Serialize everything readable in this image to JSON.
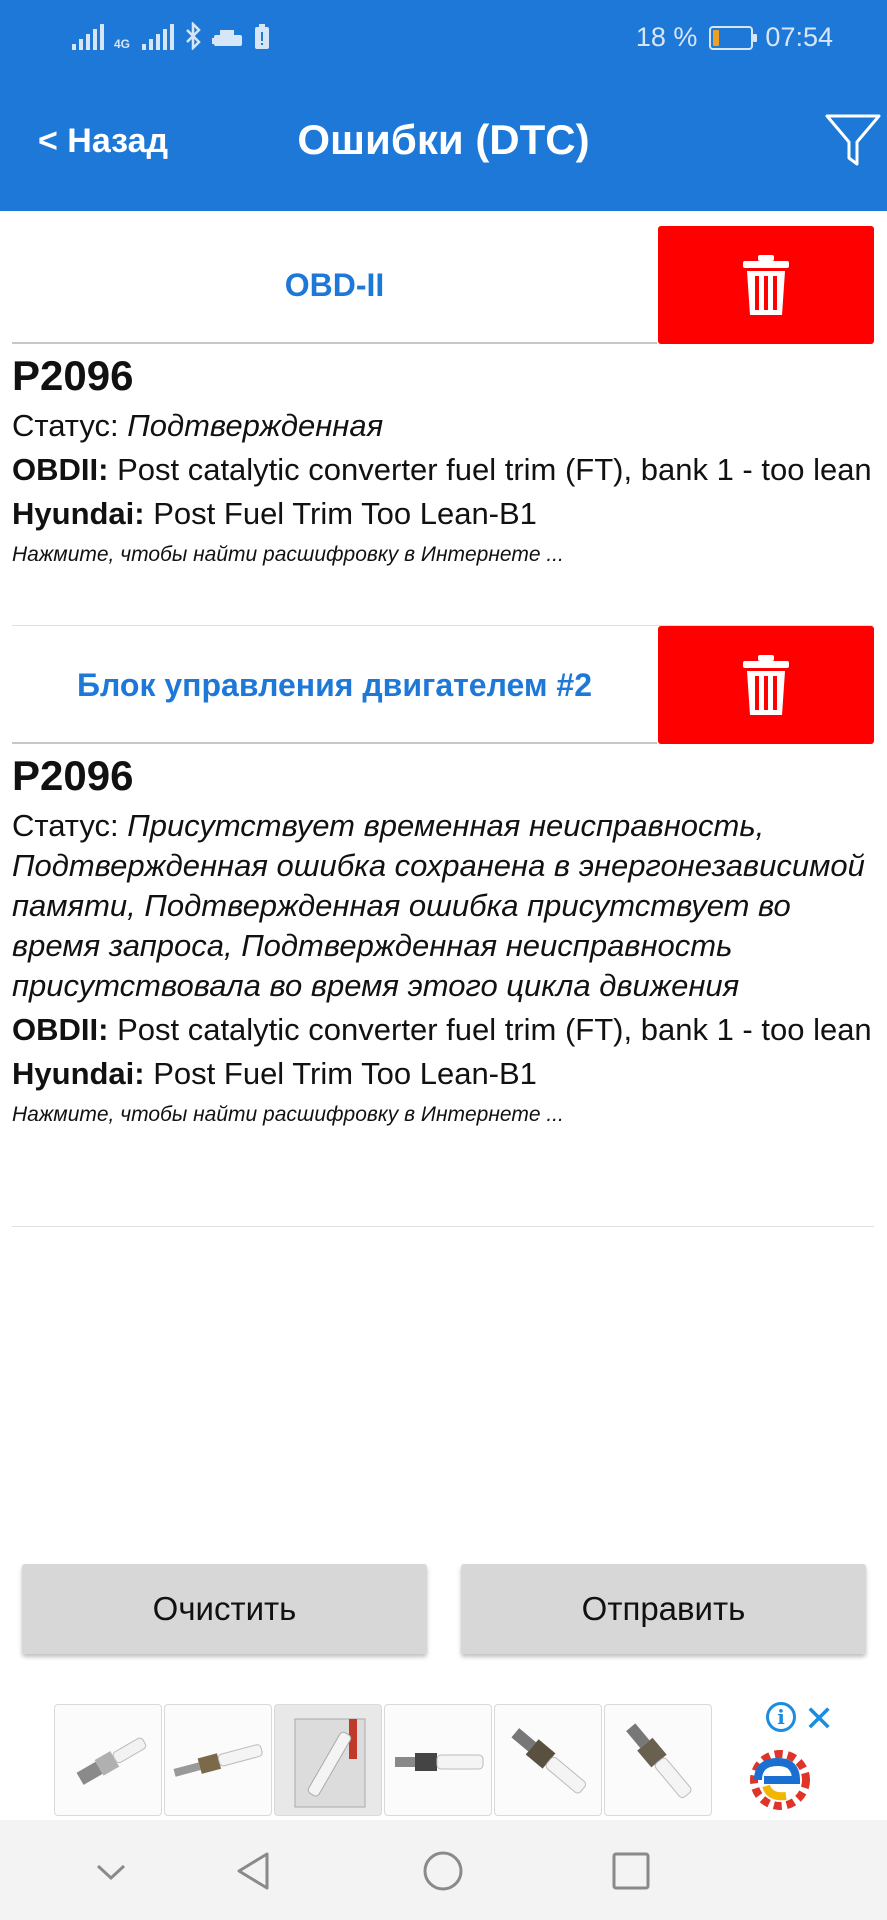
{
  "status_bar": {
    "network_label": "4G",
    "battery_percent": "18 %",
    "battery_level": 0.18,
    "time": "07:54",
    "icons": [
      "signal-icon",
      "signal-icon",
      "bluetooth-icon",
      "car-icon",
      "sim-alert-icon",
      "battery-icon"
    ]
  },
  "header": {
    "back_label": "< Назад",
    "title": "Ошибки (DTC)",
    "filter_icon": "filter-icon"
  },
  "sections": [
    {
      "title": "OBD-II",
      "delete_icon": "trash-icon",
      "code": "P2096",
      "status_label": "Статус:",
      "status_value": "Подтвержденная",
      "obd_label": "OBDII:",
      "obd_text": "Post catalytic converter fuel trim (FT), bank 1 - too lean",
      "maker_label": "Hyundai:",
      "maker_text": "Post Fuel Trim Too Lean-B1",
      "hint": "Нажмите, чтобы найти расшифровку в Интернете ..."
    },
    {
      "title": "Блок управления двигателем #2",
      "delete_icon": "trash-icon",
      "code": "P2096",
      "status_label": "Статус:",
      "status_value": "Присутствует временная неисправность, Подтвержденная ошибка сохранена в энергонезависимой памяти, Подтвержденная ошибка присутствует во время запроса, Подтвержденная неисправность присутствовала во время этого цикла движения",
      "obd_label": "OBDII:",
      "obd_text": "Post catalytic converter fuel trim (FT), bank 1 - too lean",
      "maker_label": "Hyundai:",
      "maker_text": "Post Fuel Trim Too Lean-B1",
      "hint": "Нажмите, чтобы найти расшифровку в Интернете ..."
    }
  ],
  "actions": {
    "clear_label": "Очистить",
    "send_label": "Отправить"
  },
  "ad": {
    "thumb_count": 6,
    "info_icon": "i",
    "close_icon": "✕"
  },
  "system_nav": [
    "chevron-down-icon",
    "back-triangle-icon",
    "home-circle-icon",
    "recents-square-icon"
  ],
  "colors": {
    "accent": "#1e78d7",
    "delete": "#ff0000",
    "button_bg": "#d7d7d7"
  }
}
